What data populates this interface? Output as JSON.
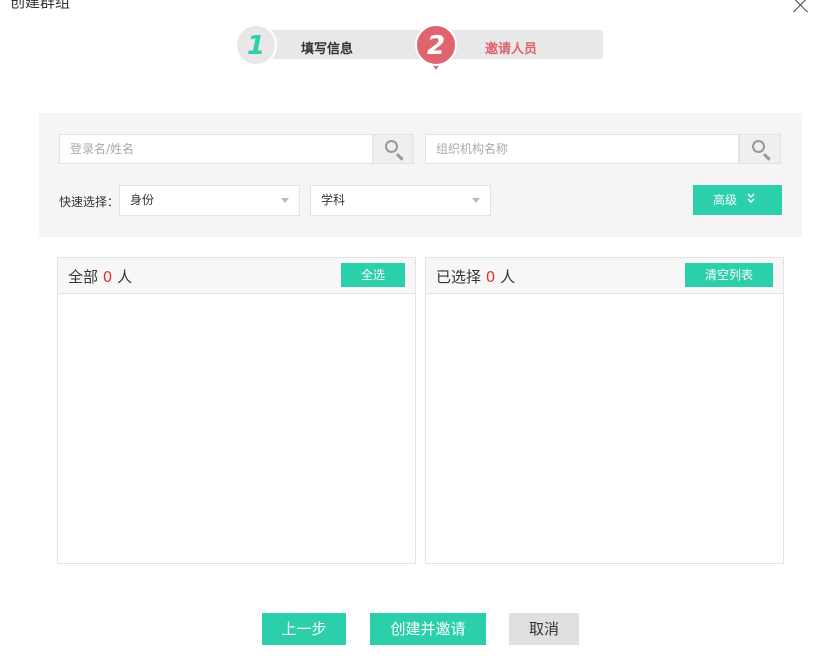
{
  "dialog": {
    "title": "创建群组"
  },
  "steps": [
    {
      "number": "1",
      "label": "填写信息"
    },
    {
      "number": "2",
      "label": "邀请人员"
    }
  ],
  "search": {
    "name_placeholder": "登录名/姓名",
    "org_placeholder": "组织机构名称"
  },
  "quick_select": {
    "label": "快速选择：",
    "identity": "身份",
    "subject": "学科",
    "advanced": "高级"
  },
  "left_panel": {
    "prefix": "全部",
    "count": "0",
    "suffix": "人",
    "button": "全选"
  },
  "right_panel": {
    "prefix": "已选择",
    "count": "0",
    "suffix": "人",
    "button": "清空列表"
  },
  "footer": {
    "prev": "上一步",
    "create": "创建并邀请",
    "cancel": "取消"
  },
  "colors": {
    "accent": "#2bd0ab",
    "step_active": "#e0636e",
    "count": "#e3322f"
  },
  "icons": [
    "close-icon",
    "search-icon",
    "chevron-down-icon"
  ]
}
